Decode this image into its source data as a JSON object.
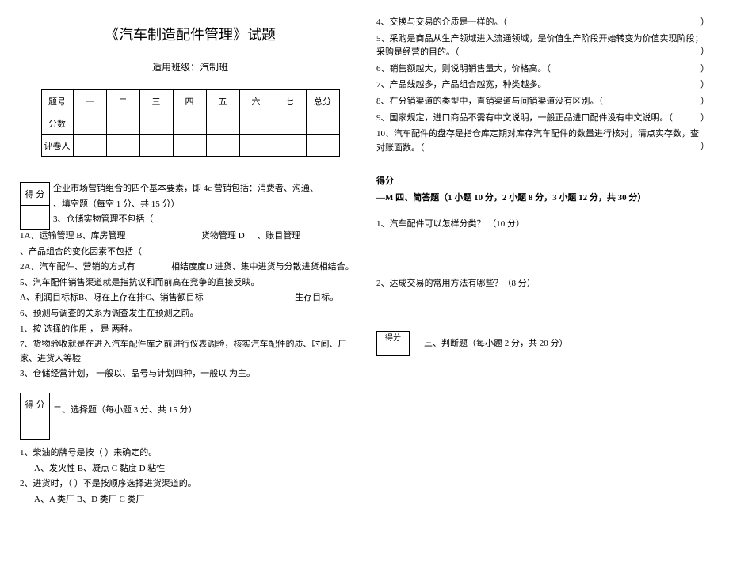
{
  "title": "《汽车制造配件管理》试题",
  "subtitle": "适用班级：汽制班",
  "score_table": {
    "row_labels": [
      "题号",
      "分数",
      "评卷人"
    ],
    "cols": [
      "一",
      "二",
      "三",
      "四",
      "五",
      "六",
      "七",
      "总分"
    ]
  },
  "score_box": {
    "label": "得  分"
  },
  "sections": {
    "s1": {
      "heading_extra": "企业市场营销组合的四个基本要素，即 4c 营销包括：消费者、沟通、",
      "heading": "、填空题（每空 1 分、共 15 分）",
      "pre": "3、仓储实物管理不包括（",
      "q1a": "1A、运输管理 B、库房管理",
      "q1b": "货物管理 D",
      "q1c": "、账目管理",
      "q2": "、产品组合的变化因素不包括（",
      "q3a": "2A、汽车配件、营销的方式有",
      "q3b": "相结度度D 进货、集中进货与分散进货相结合。",
      "q4": "5、汽车配件销售渠道就是指抗议和而前高在竞争的直接反映。",
      "q5a": "A、利润目标标B、呀在上存在排C、销售额目标",
      "q5b": "生存目标。",
      "q6": "6、预测与调查的关系为调查发生在预测之前。",
      "q7a": "1、按  选择的作用 ，  是        两种。",
      "q7b": "7、货物验收就是在进入汽车配件库之前进行仪表调验，核实汽车配件的质、时间、厂家、进货人等验",
      "q8": "3、仓储经营计划，  一般以、品号与计划四种，一般以    为主。"
    },
    "s2": {
      "heading": "二、选择题（每小题  3 分、共 15 分）",
      "q1": "1、柴油的牌号是按（          ）来确定的。",
      "q1o": "A、发火性 B、凝点 C              黏度  D           粘性",
      "q2": "2、进货时，（            ）不是按顺序选择进货渠道的。",
      "q2o": "A、A 类厂                            B、D 类厂              C 类厂"
    },
    "s3": {
      "heading": "三、判断题（每小题 2 分，共 20 分）",
      "q4": "4、交换与交易的介质是一样的。（",
      "q5": "5、采购是商品从生产领域进入流通领域，是价值生产阶段开始转变为价值实现阶段；采购是经营的目的。（",
      "q6": "6、销售额越大，则说明销售量大，价格高。（",
      "q7": "7、产品线越多，产品组合越宽，种类越多。",
      "q8": "8、在分销渠道的类型中，直销渠道与间销渠道没有区别。（",
      "q9": "9、国家规定，进口商品不需有中文说明，一般正品进口配件没有中文说明。（",
      "q10": "10、汽车配件的盘存是指仓库定期对库存汽车配件的数量进行核对，清点实存数，查对账面数。（",
      "rp": "）"
    },
    "s4": {
      "pre": "得分",
      "heading": "—M 四、简答题（1 小题 10 分，2 小题 8 分，3 小题 12 分，共 30 分）",
      "q1": "1、汽车配件可以怎样分类？ （10 分）",
      "q2": "2、达成交易的常用方法有哪些？（8 分）"
    }
  }
}
